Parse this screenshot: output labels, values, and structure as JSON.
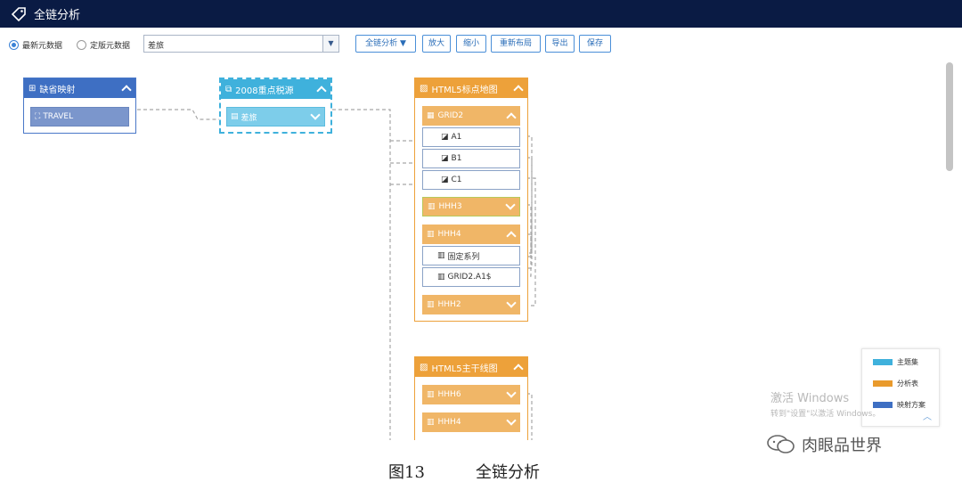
{
  "app": {
    "title": "全链分析",
    "tag_icon": "tag-icon"
  },
  "toolbar": {
    "radio_latest": "最新元数据",
    "radio_fixed": "定版元数据",
    "selected_radio": "radio_latest",
    "select_value": "差旅",
    "buttons": {
      "analysis": "全链分析 ▼",
      "zoom_in": "放大",
      "zoom_out": "缩小",
      "relayout": "重新布局",
      "export": "导出",
      "save": "保存"
    }
  },
  "nodes": {
    "mapping": {
      "title": "缺省映射",
      "item": "TRAVEL"
    },
    "theme": {
      "title": "2008重点税源",
      "item": "差旅"
    },
    "map_report": {
      "title": "HTML5标点地图",
      "grid": {
        "title": "GRID2",
        "items": [
          "A1",
          "B1",
          "C1"
        ]
      },
      "hhh3": "HHH3",
      "hhh4": {
        "title": "HHH4",
        "items": [
          "固定系列",
          "GRID2.A1$"
        ]
      },
      "hhh2": "HHH2"
    },
    "trunk_report": {
      "title": "HTML5主干线图",
      "hhh6": "HHH6",
      "hhh4b": "HHH4"
    }
  },
  "legend": {
    "items": [
      {
        "label": "主题集",
        "color": "#3fb1dc"
      },
      {
        "label": "分析表",
        "color": "#e99a2c"
      },
      {
        "label": "映射方案",
        "color": "#3e6fc3"
      }
    ]
  },
  "watermark": {
    "line1": "激活 Windows",
    "line2": "转到\"设置\"以激活 Windows。"
  },
  "brand": "肉眼品世界",
  "caption": {
    "fig": "图13",
    "text": "全链分析"
  }
}
